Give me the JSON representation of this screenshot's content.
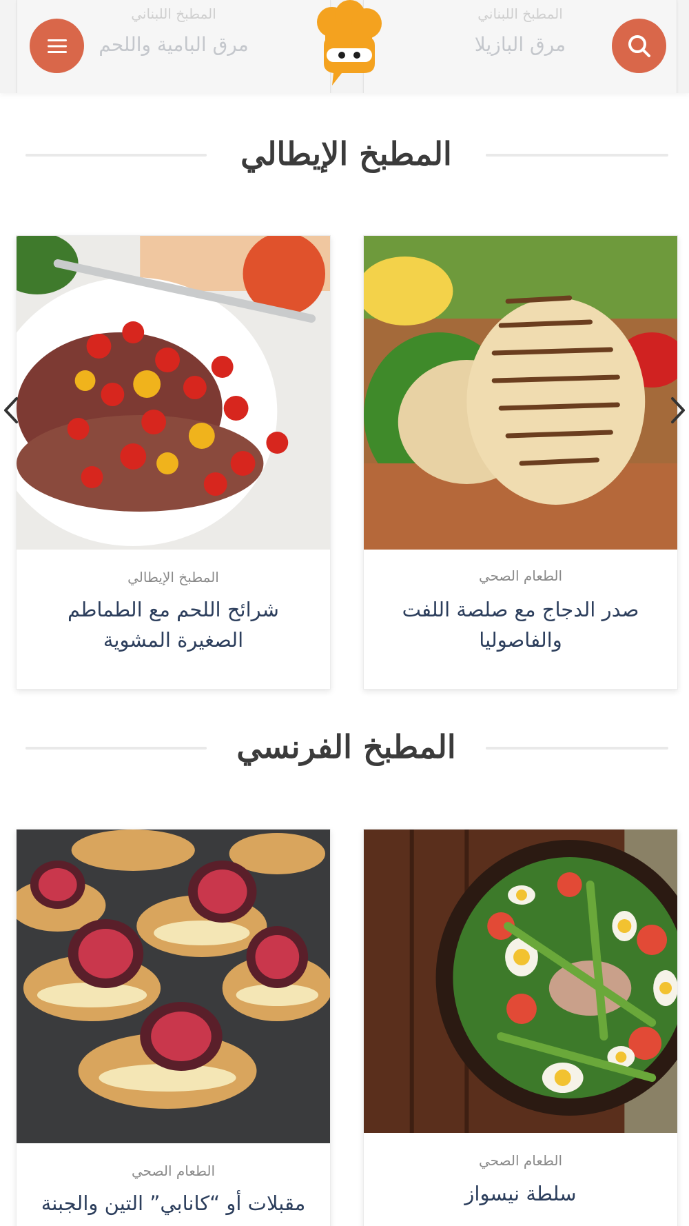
{
  "header": {
    "ghost_cards": [
      {
        "category": "المطبخ اللبناني",
        "title": "مرق البامية واللحم"
      },
      {
        "category": "المطبخ اللبناني",
        "title": "مرق البازيلا"
      }
    ],
    "menu_icon": "hamburger-menu-icon",
    "search_icon": "search-icon",
    "logo": "chef-hat-logo"
  },
  "sections": [
    {
      "title": "المطبخ الإيطالي",
      "cards": [
        {
          "category": "المطبخ الإيطالي",
          "title": "شرائح اللحم مع الطماطم الصغيرة المشوية",
          "image": "grilled steak slices with roasted cherry tomatoes"
        },
        {
          "category": "الطعام الصحي",
          "title": "صدر الدجاج مع صلصة اللفت والفاصوليا",
          "image": "grilled chicken breast on wooden board with salad"
        }
      ]
    },
    {
      "title": "المطبخ الفرنسي",
      "cards": [
        {
          "category": "الطعام الصحي",
          "title": "مقبلات أو “كانابي” التين والجبنة",
          "image": "fig and cheese canapés on slate"
        },
        {
          "category": "الطعام الصحي",
          "title": "سلطة نيسواز",
          "image": "niçoise salad bowl with eggs, tuna and asparagus"
        }
      ]
    }
  ],
  "carousel": {
    "prev_icon": "chevron-left-icon",
    "next_icon": "chevron-right-icon"
  },
  "colors": {
    "accent": "#d9674a",
    "logo_orange": "#f4a21f",
    "title_text": "#2c3e5c"
  }
}
